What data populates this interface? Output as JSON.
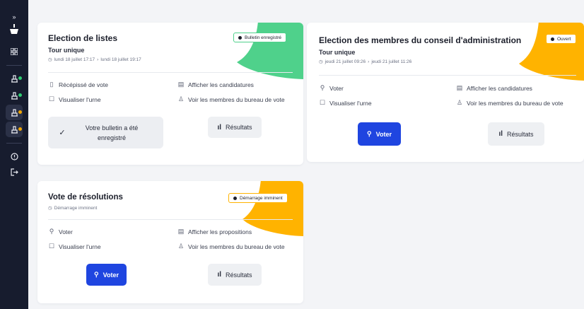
{
  "sidebar": {
    "expand_glyph": "»",
    "logo_glyph": "▲",
    "dot_colors": {
      "green": "#2ecc71",
      "orange": "#f0a500"
    }
  },
  "cards": [
    {
      "title": "Election de listes",
      "subtitle": "Tour unique",
      "date_start": "lundi 18 juillet 17:17",
      "date_end": "lundi 18 juillet 19:17",
      "badge": "Bulletin enregistré",
      "accent": "#4fd18b",
      "actions": [
        "Récépissé de vote",
        "Afficher les candidatures",
        "Visualiser l'urne",
        "Voir les membres du bureau de vote"
      ],
      "done_label": "Votre bulletin a été enregistré",
      "results_label": "Résultats"
    },
    {
      "title": "Election des membres du conseil d'administration",
      "subtitle": "Tour unique",
      "date_start": "jeudi 21 juillet 09:26",
      "date_end": "jeudi 21 juillet 11:26",
      "badge": "Ouvert",
      "accent": "#ffb300",
      "actions": [
        "Voter",
        "Afficher les candidatures",
        "Visualiser l'urne",
        "Voir les membres du bureau de vote"
      ],
      "vote_label": "Voter",
      "results_label": "Résultats"
    },
    {
      "title": "Vote de résolutions",
      "subtitle_status": "Démarrage imminent",
      "badge": "Démarrage imminent",
      "accent": "#ffb300",
      "actions": [
        "Voter",
        "Afficher les propositions",
        "Visualiser l'urne",
        "Voir les membres du bureau de vote"
      ],
      "vote_label": "Voter",
      "results_label": "Résultats"
    }
  ]
}
